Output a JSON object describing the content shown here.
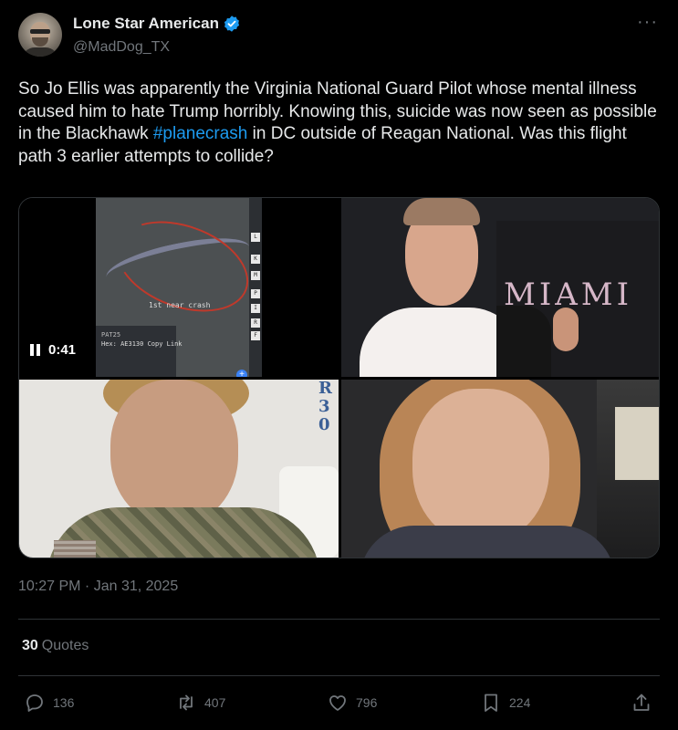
{
  "author": {
    "display_name": "Lone Star American",
    "handle": "@MadDog_TX",
    "verified_icon": "verified-badge-icon",
    "more_label": "···"
  },
  "tweet": {
    "text_before": "So Jo Ellis was apparently the Virginia National Guard Pilot whose mental illness caused him to hate Trump horribly. Knowing this, suicide was now seen as possible in the Blackhawk ",
    "hashtag": "#planecrash",
    "text_after": " in DC outside of Reagan National. Was this flight path 3 earlier attempts to collide?",
    "timestamp": "10:27 PM · Jan 31, 2025"
  },
  "media": {
    "video_time": "0:41",
    "map_label": "1st near crash",
    "flight_id": "PAT25",
    "hex_line": "Hex: AE3130  Copy Link",
    "map_sidebar_letters": [
      "L",
      "K",
      "M",
      "P",
      "I",
      "R",
      "F"
    ],
    "photo2_sign": "MIAMI",
    "photo3_sign": "R 3 0"
  },
  "stats": {
    "quotes_count": "30",
    "quotes_label": "Quotes"
  },
  "actions": {
    "replies": "136",
    "reposts": "407",
    "likes": "796",
    "bookmarks": "224"
  },
  "colors": {
    "background": "#000000",
    "text": "#e7e9ea",
    "secondary": "#71767b",
    "accent": "#1d9bf0",
    "divider": "#2f3336"
  }
}
